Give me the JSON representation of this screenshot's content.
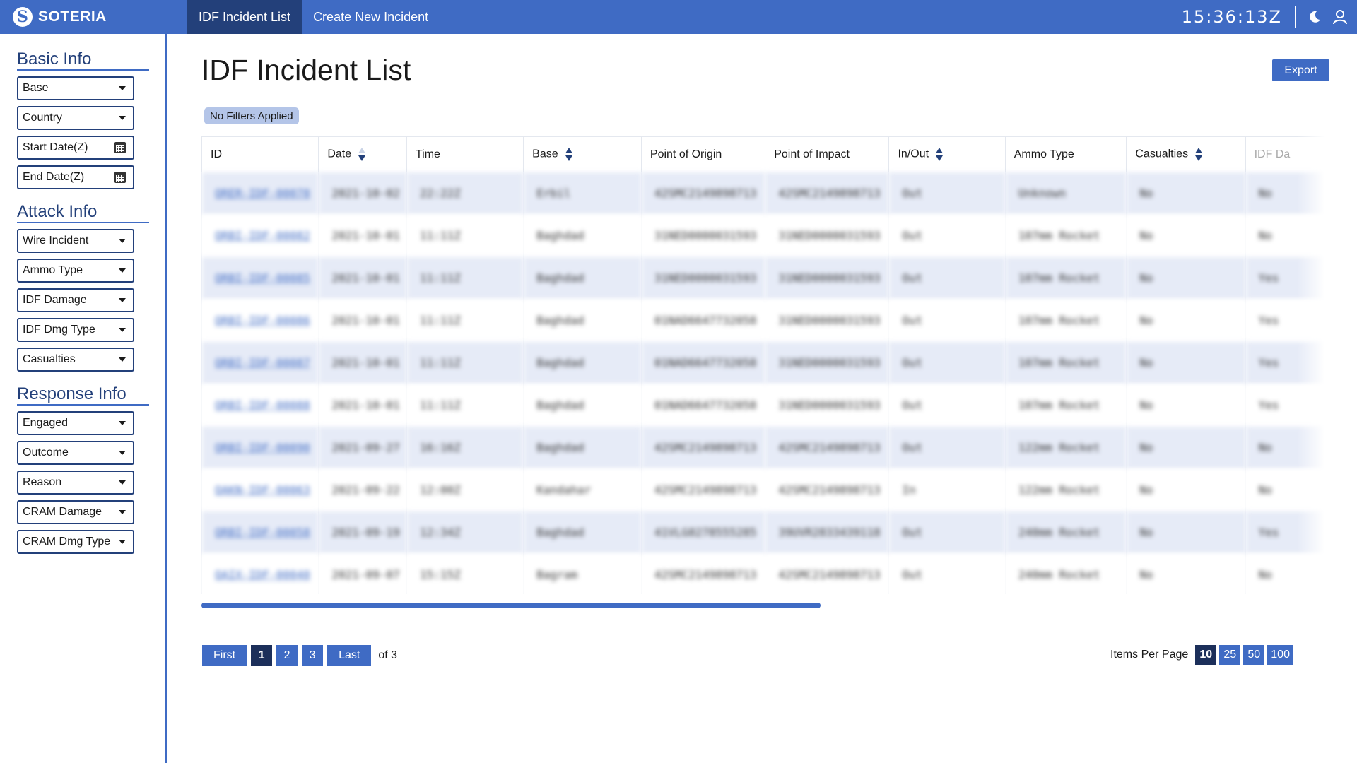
{
  "app": {
    "brand": "SOTERIA",
    "logo_letter": "S",
    "nav_tabs": [
      {
        "label": "IDF Incident List",
        "active": true
      },
      {
        "label": "Create New Incident",
        "active": false
      }
    ],
    "clock": "15:36:13Z",
    "icons": [
      "moon-icon",
      "user-icon"
    ]
  },
  "sidebar": {
    "basic_title": "Basic Info",
    "basic": [
      "Base",
      "Country",
      "Start Date(Z)",
      "End Date(Z)"
    ],
    "attack_title": "Attack Info",
    "attack": [
      "Wire Incident",
      "Ammo Type",
      "IDF Damage",
      "IDF Dmg Type",
      "Casualties"
    ],
    "response_title": "Response Info",
    "response": [
      "Engaged",
      "Outcome",
      "Reason",
      "CRAM Damage",
      "CRAM Dmg Type"
    ]
  },
  "main": {
    "title": "IDF Incident List",
    "export_label": "Export",
    "filter_chip": "No Filters Applied"
  },
  "table": {
    "headers": [
      "ID",
      "Date",
      "Time",
      "Base",
      "Point of Origin",
      "Point of Impact",
      "In/Out",
      "Ammo Type",
      "Casualties",
      "IDF Da"
    ],
    "rows": [
      [
        "ORER-IDF-00078",
        "2021-10-02",
        "22:22Z",
        "Erbil",
        "42SMC2149898713",
        "42SMC2149898713",
        "Out",
        "Unknown",
        "No",
        "No"
      ],
      [
        "ORBI-IDF-00082",
        "2021-10-01",
        "11:11Z",
        "Baghdad",
        "31NED0000031593",
        "31NED0000031593",
        "Out",
        "107mm Rocket",
        "No",
        "No"
      ],
      [
        "ORBI-IDF-00085",
        "2021-10-01",
        "11:11Z",
        "Baghdad",
        "31NED0000031593",
        "31NED0000031593",
        "Out",
        "107mm Rocket",
        "No",
        "Yes"
      ],
      [
        "ORBI-IDF-00086",
        "2021-10-01",
        "11:11Z",
        "Baghdad",
        "01NAD6647732058",
        "31NED0000031593",
        "Out",
        "107mm Rocket",
        "No",
        "Yes"
      ],
      [
        "ORBI-IDF-00087",
        "2021-10-01",
        "11:11Z",
        "Baghdad",
        "01NAD6647732058",
        "31NED0000031593",
        "Out",
        "107mm Rocket",
        "No",
        "Yes"
      ],
      [
        "ORBI-IDF-00088",
        "2021-10-01",
        "11:11Z",
        "Baghdad",
        "01NAD6647732058",
        "31NED0000031593",
        "Out",
        "107mm Rocket",
        "No",
        "Yes"
      ],
      [
        "ORBI-IDF-00090",
        "2021-09-27",
        "16:16Z",
        "Baghdad",
        "42SMC2149898713",
        "42SMC2149898713",
        "Out",
        "122mm Rocket",
        "No",
        "No"
      ],
      [
        "OAKN-IDF-00063",
        "2021-09-22",
        "12:00Z",
        "Kandahar",
        "42SMC2149898713",
        "42SMC2149898713",
        "In",
        "122mm Rocket",
        "No",
        "No"
      ],
      [
        "ORBI-IDF-00058",
        "2021-09-19",
        "12:34Z",
        "Baghdad",
        "41VLG0278555285",
        "39UVR2833439118",
        "Out",
        "240mm Rocket",
        "No",
        "Yes"
      ],
      [
        "OAIX-IDF-00040",
        "2021-09-07",
        "15:15Z",
        "Bagram",
        "42SMC2149898713",
        "42SMC2149898713",
        "Out",
        "240mm Rocket",
        "No",
        "No"
      ]
    ]
  },
  "pagination": {
    "first": "First",
    "pages": [
      "1",
      "2",
      "3"
    ],
    "current": "1",
    "last": "Last",
    "of_text": "of 3",
    "items_label": "Items Per Page",
    "sizes": [
      "10",
      "25",
      "50",
      "100"
    ],
    "current_size": "10"
  }
}
